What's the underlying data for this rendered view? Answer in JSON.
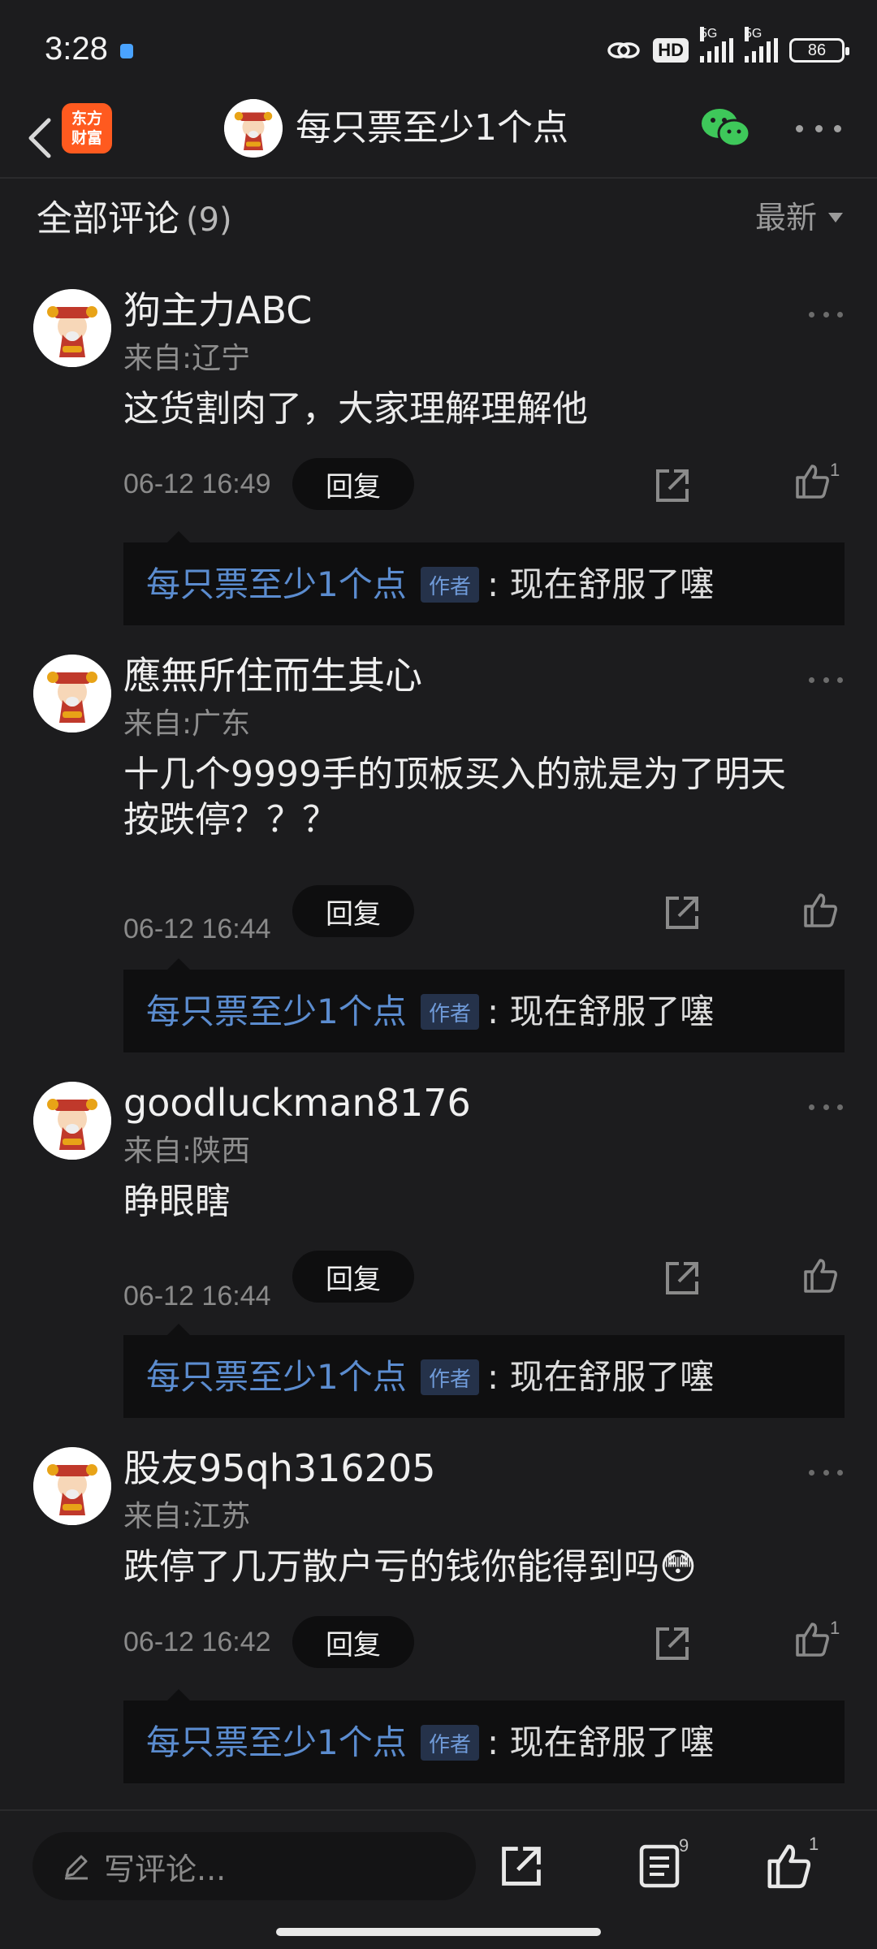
{
  "status": {
    "time": "3:28",
    "hd": "HD",
    "net1": "5G",
    "net2": "5G",
    "battery": "86"
  },
  "header": {
    "logo_line1": "东方",
    "logo_line2": "财富",
    "title": "每只票至少1个点"
  },
  "comments_header": {
    "title": "全部评论",
    "count": "(9)",
    "sort": "最新"
  },
  "comments": [
    {
      "name": "狗主力ABC",
      "location": "来自:辽宁",
      "text": [
        "这货割肉了，大家理解理解他"
      ],
      "time": "06-12 16:49",
      "reply_label": "回复",
      "likes": "1",
      "reply": {
        "author": "每只票至少1个点",
        "badge": "作者",
        "text": ": 现在舒服了噻"
      }
    },
    {
      "name": "應無所住而生其心",
      "location": "来自:广东",
      "text": [
        "十几个9999手的顶板买入的就是为了明天",
        "按跌停？？？"
      ],
      "time": "06-12 16:44",
      "reply_label": "回复",
      "likes": "",
      "reply": {
        "author": "每只票至少1个点",
        "badge": "作者",
        "text": ": 现在舒服了噻"
      }
    },
    {
      "name": "goodluckman8176",
      "location": "来自:陕西",
      "text": [
        "睁眼瞎"
      ],
      "time": "06-12 16:44",
      "reply_label": "回复",
      "likes": "",
      "reply": {
        "author": "每只票至少1个点",
        "badge": "作者",
        "text": ": 现在舒服了噻"
      }
    },
    {
      "name": "股友95qh316205",
      "location": "来自:江苏",
      "text": [
        "跌停了几万散户亏的钱你能得到吗"
      ],
      "emoji": "😳",
      "time": "06-12 16:42",
      "reply_label": "回复",
      "likes": "1",
      "reply": {
        "author": "每只票至少1个点",
        "badge": "作者",
        "text": ": 现在舒服了噻"
      }
    }
  ],
  "bottom_bar": {
    "write_placeholder": "写评论...",
    "comment_count": "9",
    "like_count": "1"
  },
  "colors": {
    "background": "#1c1c1e",
    "author_blue": "#5b8ccf",
    "logo_orange": "#ff5a1f"
  }
}
